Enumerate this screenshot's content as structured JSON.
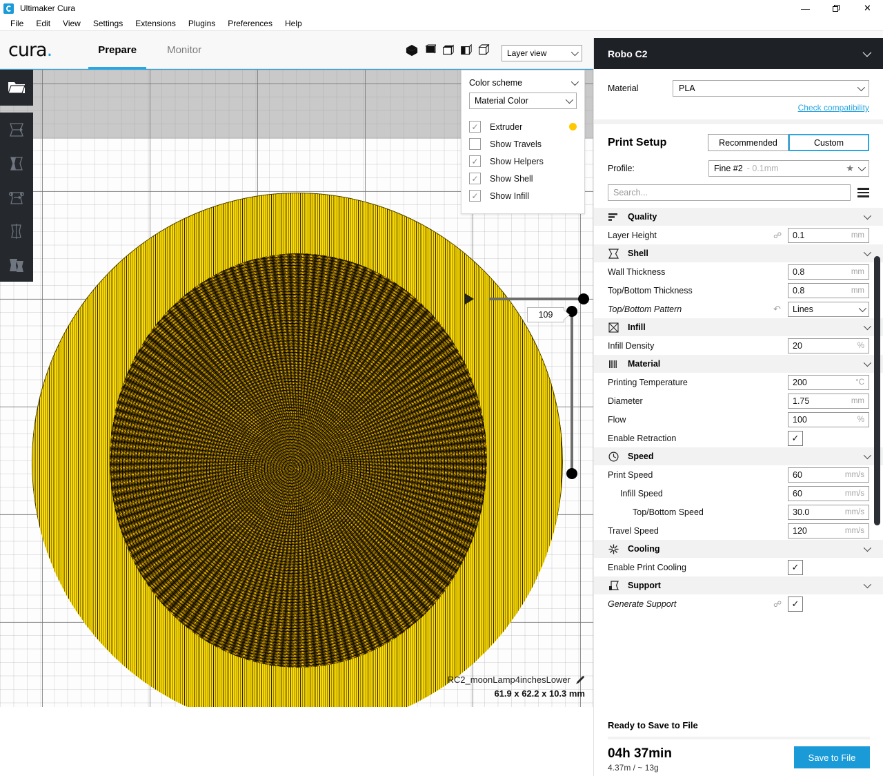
{
  "window": {
    "title": "Ultimaker Cura",
    "logo_icon": "cura-logo-icon",
    "minimize": "—",
    "maximize": "❐",
    "close": "✕"
  },
  "menubar": {
    "items": [
      "File",
      "Edit",
      "View",
      "Settings",
      "Extensions",
      "Plugins",
      "Preferences",
      "Help"
    ]
  },
  "header": {
    "wordmark": "cura",
    "wordmark_dot": ".",
    "tabs": [
      {
        "label": "Prepare",
        "active": true
      },
      {
        "label": "Monitor",
        "active": false
      }
    ],
    "view_tools": [
      "view-3d-icon",
      "view-front-icon",
      "view-top-icon",
      "view-left-icon",
      "view-right-icon"
    ],
    "view_mode": {
      "value": "Layer view",
      "chevron": "chevron-down-icon"
    }
  },
  "left_toolbar": {
    "open_file": "open-folder-icon",
    "tools": [
      "move-tool-icon",
      "scale-tool-icon",
      "rotate-tool-icon",
      "mirror-tool-icon",
      "per-model-settings-icon"
    ]
  },
  "legend": {
    "title": "Color scheme",
    "scheme_value": "Material Color",
    "rows": [
      {
        "label": "Extruder",
        "checked": true,
        "swatch": "#ffc800"
      },
      {
        "label": "Show Travels",
        "checked": false,
        "swatch": null
      },
      {
        "label": "Show Helpers",
        "checked": true,
        "swatch": null
      },
      {
        "label": "Show Shell",
        "checked": true,
        "swatch": null
      },
      {
        "label": "Show Infill",
        "checked": true,
        "swatch": null
      }
    ],
    "check_glyph": "✓"
  },
  "viewport": {
    "play_icon": "play-icon",
    "layer_value": "109",
    "model_name": "RC2_moonLamp4inchesLower",
    "edit_icon": "pencil-icon",
    "model_dimensions": "61.9 x 62.2 x 10.3 mm"
  },
  "sidebar": {
    "printer_name": "Robo C2",
    "printer_chevron": "chevron-down-icon",
    "material_label": "Material",
    "material_value": "PLA",
    "check_compatibility": "Check compatibility",
    "print_setup_title": "Print Setup",
    "modes": [
      {
        "label": "Recommended",
        "active": false
      },
      {
        "label": "Custom",
        "active": true
      }
    ],
    "profile_label": "Profile:",
    "profile_value": "Fine #2",
    "profile_quality": "- 0.1mm",
    "profile_star": "★",
    "search_placeholder": "Search...",
    "menu_icon": "hamburger-icon",
    "categories": [
      {
        "name": "Quality",
        "icon": "quality-icon",
        "settings": [
          {
            "name": "Layer Height",
            "value": "0.1",
            "unit": "mm",
            "type": "text",
            "link": true,
            "indent": 0
          }
        ]
      },
      {
        "name": "Shell",
        "icon": "shell-icon",
        "settings": [
          {
            "name": "Wall Thickness",
            "value": "0.8",
            "unit": "mm",
            "type": "text",
            "indent": 0
          },
          {
            "name": "Top/Bottom Thickness",
            "value": "0.8",
            "unit": "mm",
            "type": "text",
            "indent": 0
          },
          {
            "name": "Top/Bottom Pattern",
            "value": "Lines",
            "unit": "",
            "type": "select",
            "reset": true,
            "italic": true,
            "indent": 0
          }
        ]
      },
      {
        "name": "Infill",
        "icon": "infill-icon",
        "settings": [
          {
            "name": "Infill Density",
            "value": "20",
            "unit": "%",
            "type": "text",
            "indent": 0
          }
        ]
      },
      {
        "name": "Material",
        "icon": "material-icon",
        "settings": [
          {
            "name": "Printing Temperature",
            "value": "200",
            "unit": "°C",
            "type": "text",
            "indent": 0
          },
          {
            "name": "Diameter",
            "value": "1.75",
            "unit": "mm",
            "type": "text",
            "indent": 0
          },
          {
            "name": "Flow",
            "value": "100",
            "unit": "%",
            "type": "text",
            "indent": 0
          },
          {
            "name": "Enable Retraction",
            "value": "✓",
            "type": "checkbox",
            "indent": 0
          }
        ]
      },
      {
        "name": "Speed",
        "icon": "speed-icon",
        "settings": [
          {
            "name": "Print Speed",
            "value": "60",
            "unit": "mm/s",
            "type": "text",
            "indent": 0
          },
          {
            "name": "Infill Speed",
            "value": "60",
            "unit": "mm/s",
            "type": "text",
            "indent": 1
          },
          {
            "name": "Top/Bottom Speed",
            "value": "30.0",
            "unit": "mm/s",
            "type": "text",
            "indent": 2
          },
          {
            "name": "Travel Speed",
            "value": "120",
            "unit": "mm/s",
            "type": "text",
            "indent": 0
          }
        ]
      },
      {
        "name": "Cooling",
        "icon": "cooling-icon",
        "settings": [
          {
            "name": "Enable Print Cooling",
            "value": "✓",
            "type": "checkbox",
            "indent": 0
          }
        ]
      },
      {
        "name": "Support",
        "icon": "support-icon",
        "settings": [
          {
            "name": "Generate Support",
            "value": "✓",
            "type": "checkbox",
            "link": true,
            "italic": true,
            "indent": 0
          }
        ]
      }
    ],
    "footer": {
      "status": "Ready to Save to File",
      "time": "04h 37min",
      "material_usage": "4.37m / ~ 13g",
      "save_label": "Save to File"
    }
  },
  "colors": {
    "accent": "#2ba6e0",
    "save_button": "#1a9bd7",
    "printer_bar": "#1e2126",
    "toolbar": "#25282d",
    "model_yellow": "#ffe000",
    "category_bg": "#f2f2f2"
  }
}
